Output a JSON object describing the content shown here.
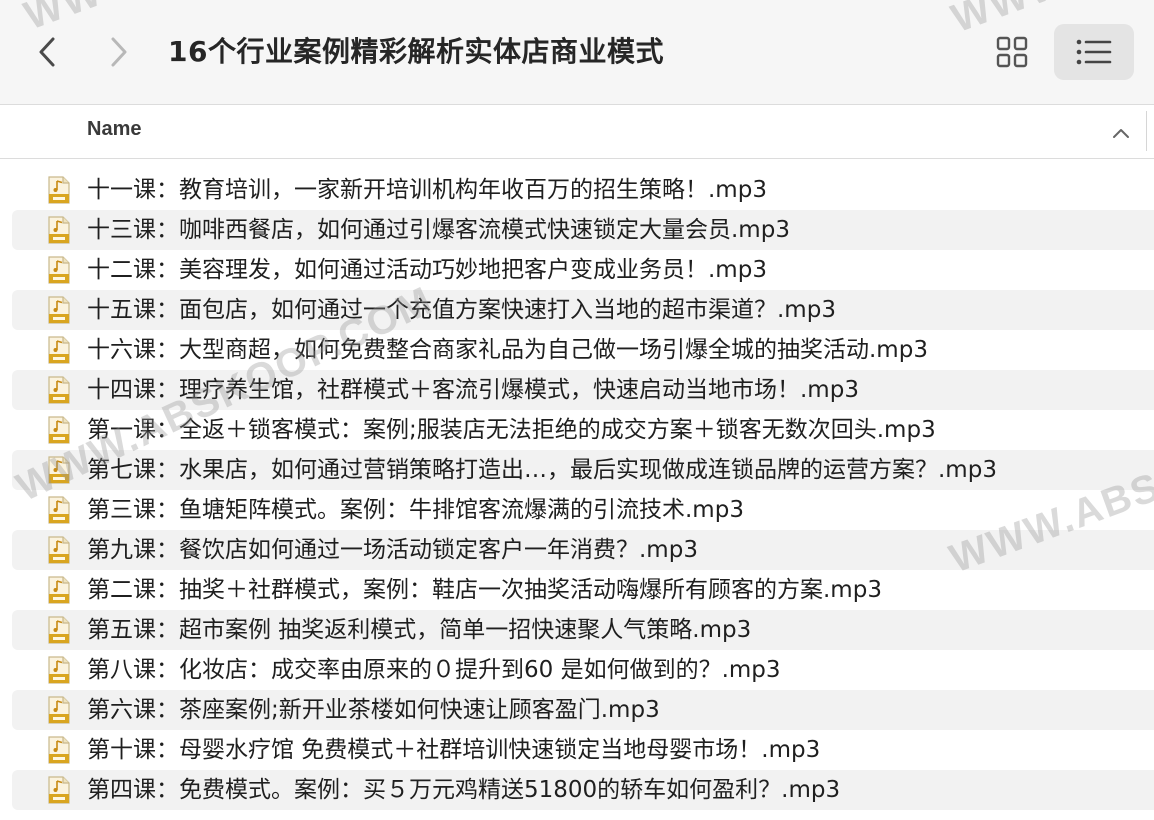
{
  "window": {
    "title": "16个行业案例精彩解析实体店商业模式"
  },
  "toolbar": {
    "back_icon": "chevron-left-icon",
    "forward_icon": "chevron-right-icon",
    "grid_view_icon": "grid-view-icon",
    "list_view_icon": "list-view-icon",
    "active_view": "list"
  },
  "columns": {
    "name_header": "Name",
    "sort_direction": "ascending"
  },
  "files": [
    {
      "name": "十一课：教育培训，一家新开培训机构年收百万的招生策略！.mp3",
      "icon": "audio-file-icon"
    },
    {
      "name": "十三课：咖啡西餐店，如何通过引爆客流模式快速锁定大量会员.mp3",
      "icon": "audio-file-icon"
    },
    {
      "name": "十二课：美容理发，如何通过活动巧妙地把客户变成业务员！.mp3",
      "icon": "audio-file-icon"
    },
    {
      "name": "十五课：面包店，如何通过一个充值方案快速打入当地的超市渠道？.mp3",
      "icon": "audio-file-icon"
    },
    {
      "name": "十六课：大型商超，如何免费整合商家礼品为自己做一场引爆全城的抽奖活动.mp3",
      "icon": "audio-file-icon"
    },
    {
      "name": "十四课：理疗养生馆，社群模式＋客流引爆模式，快速启动当地市场！.mp3",
      "icon": "audio-file-icon"
    },
    {
      "name": "第一课：全返＋锁客模式：案例;服装店无法拒绝的成交方案＋锁客无数次回头.mp3",
      "icon": "audio-file-icon"
    },
    {
      "name": "第七课：水果店，如何通过营销策略打造出…，最后实现做成连锁品牌的运营方案？.mp3",
      "icon": "audio-file-icon"
    },
    {
      "name": "第三课：鱼塘矩阵模式。案例：牛排馆客流爆满的引流技术.mp3",
      "icon": "audio-file-icon"
    },
    {
      "name": "第九课：餐饮店如何通过一场活动锁定客户一年消费？.mp3",
      "icon": "audio-file-icon"
    },
    {
      "name": "第二课：抽奖＋社群模式，案例：鞋店一次抽奖活动嗨爆所有顾客的方案.mp3",
      "icon": "audio-file-icon"
    },
    {
      "name": "第五课：超市案例 抽奖返利模式，简单一招快速聚人气策略.mp3",
      "icon": "audio-file-icon"
    },
    {
      "name": "第八课：化妆店：成交率由原来的０提升到60  是如何做到的？.mp3",
      "icon": "audio-file-icon"
    },
    {
      "name": "第六课：茶座案例;新开业茶楼如何快速让顾客盈门.mp3",
      "icon": "audio-file-icon"
    },
    {
      "name": "第十课：母婴水疗馆 免费模式＋社群培训快速锁定当地母婴市场！.mp3",
      "icon": "audio-file-icon"
    },
    {
      "name": "第四课：免费模式。案例：买５万元鸡精送51800的轿车如何盈利？.mp3",
      "icon": "audio-file-icon"
    }
  ],
  "watermark": {
    "text_main": "WWW.ABSKOOP.COM",
    "text_partial_top_left": "WW",
    "text_partial_top_right": "WWW",
    "text_partial_right": "WWW.ABS"
  }
}
